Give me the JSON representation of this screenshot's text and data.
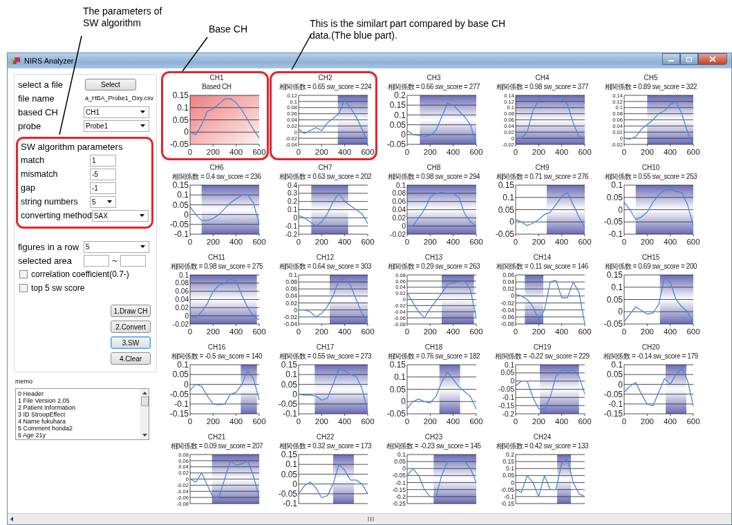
{
  "annotations": [
    {
      "text": "The parameters of SW algorithm"
    },
    {
      "text": "Base CH"
    },
    {
      "text": "This is the similart part compared by base CH data.(The blue part)."
    }
  ],
  "window": {
    "title": "NIRS Analyzer"
  },
  "file_panel": {
    "select_label": "select a file",
    "select_button": "Select",
    "file_name_label": "file name",
    "file_name": "a_HBA_Probe1_Oxy.csv",
    "based_ch_label": "based CH",
    "based_ch": "CH1",
    "probe_label": "probe",
    "probe": "Probe1"
  },
  "sw_parameters": {
    "title": "SW algorithm parameters",
    "highlighted": true,
    "fields": [
      {
        "label": "match",
        "value": "1",
        "kind": "text"
      },
      {
        "label": "mismatch",
        "value": "-5",
        "kind": "text"
      },
      {
        "label": "gap",
        "value": "-1",
        "kind": "text"
      },
      {
        "label": "string numbers",
        "value": "5",
        "kind": "dropdown"
      },
      {
        "label": "converting method",
        "value": "SAX",
        "kind": "dropdown"
      }
    ]
  },
  "display": {
    "figures_label": "figures in a row",
    "figures": "5",
    "area_label": "selected area",
    "area_separator": "～"
  },
  "options": [
    {
      "label": "correlation coefficient(0.7-)",
      "checked": false
    },
    {
      "label": "top 5 sw score",
      "checked": false
    }
  ],
  "buttons": [
    {
      "label": "1.Draw CH",
      "focused": false
    },
    {
      "label": "2.Convert",
      "focused": false
    },
    {
      "label": "3.SW",
      "focused": true
    },
    {
      "label": "4.Clear",
      "focused": false
    }
  ],
  "memo": {
    "label": "memo",
    "lines": [
      "0  Header",
      "1  File Version 2.05",
      "2  Patient Information",
      "3  ID StroopEffect",
      "4  Name fukuhara",
      "5  Comment honda2",
      "6  Age 21y"
    ]
  },
  "charts": [
    {
      "title": "CH1",
      "subtitle": "Based CH",
      "kind": "base",
      "highlighted": true,
      "chart_data": {
        "type": "line",
        "grid": true,
        "x": [
          0,
          50,
          100,
          150,
          200,
          250,
          300,
          350,
          400,
          450,
          500,
          550,
          600
        ],
        "xlim": [
          0,
          600
        ],
        "ylim": [
          -0.05,
          0.15
        ],
        "xticks": [
          0,
          200,
          400,
          600
        ],
        "yticks": [
          -0.05,
          0,
          0.05,
          0.1,
          0.15
        ],
        "series": [
          {
            "color": "#4a86d4",
            "values": [
              0,
              -0.01,
              0.03,
              0.085,
              0.095,
              0.115,
              0.135,
              0.137,
              0.12,
              0.09,
              0.05,
              0.01,
              -0.025
            ]
          }
        ]
      }
    },
    {
      "title": "CH2",
      "subtitle": "相関係数 = 0.65 sw_score = 224",
      "kind": "compared",
      "highlighted": true,
      "chart_data": {
        "type": "line",
        "grid": true,
        "x": [
          0,
          50,
          100,
          150,
          200,
          250,
          300,
          350,
          400,
          450,
          500,
          550,
          600
        ],
        "xlim": [
          0,
          600
        ],
        "ylim": [
          -0.04,
          0.12
        ],
        "xticks": [
          0,
          200,
          400,
          600
        ],
        "yticks": [
          -0.04,
          -0.02,
          0,
          0.02,
          0.04,
          0.06,
          0.08,
          0.1,
          0.12
        ],
        "series": [
          {
            "color": "#4a86d4",
            "values": [
              0.01,
              -0.005,
              0.005,
              0.015,
              0.005,
              0.03,
              0.045,
              0.06,
              0.105,
              0.08,
              0.05,
              0.01,
              -0.035
            ]
          }
        ],
        "bands": [
          {
            "axis": "x",
            "from": 340,
            "to": 600
          }
        ]
      }
    },
    {
      "title": "CH3",
      "subtitle": "相関係数 = 0.66 sw_score = 277",
      "kind": "compared",
      "highlighted": false,
      "chart_data": {
        "type": "line",
        "grid": true,
        "x": [
          0,
          50,
          100,
          150,
          200,
          250,
          300,
          350,
          400,
          450,
          500,
          550,
          600
        ],
        "xlim": [
          0,
          600
        ],
        "ylim": [
          -0.05,
          0.2
        ],
        "xticks": [
          0,
          200,
          400,
          600
        ],
        "yticks": [
          -0.05,
          0,
          0.05,
          0.1,
          0.15,
          0.2
        ],
        "series": [
          {
            "color": "#4a86d4",
            "values": [
              0.02,
              0,
              -0.005,
              -0.01,
              -0.005,
              0.02,
              0.09,
              0.16,
              0.15,
              0.12,
              0.09,
              0.05,
              -0.05
            ]
          }
        ],
        "bands": [
          {
            "axis": "x",
            "from": 110,
            "to": 600
          }
        ]
      }
    },
    {
      "title": "CH4",
      "subtitle": "相関係数 = 0.98 sw_score = 377",
      "kind": "compared",
      "highlighted": false,
      "chart_data": {
        "type": "line",
        "grid": true,
        "x": [
          0,
          50,
          100,
          150,
          200,
          250,
          300,
          350,
          400,
          450,
          500,
          550,
          600
        ],
        "xlim": [
          0,
          600
        ],
        "ylim": [
          -0.02,
          0.14
        ],
        "xticks": [
          0,
          200,
          400,
          600
        ],
        "yticks": [
          -0.02,
          0,
          0.02,
          0.04,
          0.06,
          0.08,
          0.1,
          0.12,
          0.14
        ],
        "series": [
          {
            "color": "#4a86d4",
            "values": [
              0,
              0,
              0.02,
              0.09,
              0.125,
              0.133,
              0.135,
              0.132,
              0.13,
              0.11,
              0.05,
              0.005,
              0
            ]
          }
        ],
        "bands": [
          {
            "axis": "x",
            "from": 0,
            "to": 600
          }
        ]
      }
    },
    {
      "title": "CH5",
      "subtitle": "相関係数 = 0.89 sw_score = 322",
      "kind": "compared",
      "highlighted": false,
      "chart_data": {
        "type": "line",
        "grid": true,
        "x": [
          0,
          50,
          100,
          150,
          200,
          250,
          300,
          350,
          400,
          450,
          500,
          550,
          600
        ],
        "xlim": [
          0,
          600
        ],
        "ylim": [
          -0.02,
          0.14
        ],
        "xticks": [
          0,
          200,
          400,
          600
        ],
        "yticks": [
          -0.02,
          0,
          0.02,
          0.04,
          0.06,
          0.08,
          0.1,
          0.12,
          0.14
        ],
        "series": [
          {
            "color": "#4a86d4",
            "values": [
              0,
              -0.003,
              0.005,
              0.03,
              0.045,
              0.06,
              0.08,
              0.09,
              0.11,
              0.12,
              0.08,
              0.02,
              -0.02
            ]
          }
        ],
        "bands": [
          {
            "axis": "x",
            "from": 200,
            "to": 600
          }
        ]
      }
    },
    {
      "title": "CH6",
      "subtitle": "相関係数 = 0.4 sw_score = 236",
      "kind": "compared",
      "highlighted": false,
      "chart_data": {
        "type": "line",
        "grid": true,
        "x": [
          0,
          50,
          100,
          150,
          200,
          250,
          300,
          350,
          400,
          450,
          500,
          550,
          600
        ],
        "xlim": [
          0,
          600
        ],
        "ylim": [
          -0.1,
          0.15
        ],
        "xticks": [
          0,
          200,
          400,
          600
        ],
        "yticks": [
          -0.1,
          -0.05,
          0,
          0.05,
          0.1,
          0.15
        ],
        "series": [
          {
            "color": "#4a86d4",
            "values": [
              0.04,
              0,
              -0.03,
              -0.03,
              -0.02,
              0,
              0.03,
              0.06,
              0.08,
              0.1,
              0.1,
              0.06,
              -0.05
            ]
          }
        ],
        "bands": [
          {
            "axis": "x",
            "from": 100,
            "to": 600
          }
        ]
      }
    },
    {
      "title": "CH7",
      "subtitle": "相関係数 = 0.63 sw_score = 202",
      "kind": "compared",
      "highlighted": false,
      "chart_data": {
        "type": "line",
        "grid": true,
        "x": [
          0,
          50,
          100,
          150,
          200,
          250,
          300,
          350,
          400,
          450,
          500,
          550,
          600
        ],
        "xlim": [
          0,
          600
        ],
        "ylim": [
          -0.2,
          0.4
        ],
        "xticks": [
          0,
          200,
          400,
          600
        ],
        "yticks": [
          -0.2,
          -0.1,
          0,
          0.1,
          0.2,
          0.3,
          0.4
        ],
        "series": [
          {
            "color": "#4a86d4",
            "values": [
              0.03,
              0,
              -0.05,
              -0.1,
              -0.05,
              0.05,
              0.2,
              0.3,
              0.2,
              0.15,
              0.1,
              0.05,
              -0.07
            ]
          }
        ],
        "bands": [
          {
            "axis": "x",
            "from": 110,
            "to": 430
          }
        ]
      }
    },
    {
      "title": "CH8",
      "subtitle": "相関係数 = 0.98 sw_score = 294",
      "kind": "compared",
      "highlighted": false,
      "chart_data": {
        "type": "line",
        "grid": true,
        "x": [
          0,
          50,
          100,
          150,
          200,
          250,
          300,
          350,
          400,
          450,
          500,
          550,
          600
        ],
        "xlim": [
          0,
          600
        ],
        "ylim": [
          -0.02,
          0.1
        ],
        "xticks": [
          0,
          200,
          400,
          600
        ],
        "yticks": [
          -0.02,
          0,
          0.02,
          0.04,
          0.06,
          0.08,
          0.1
        ],
        "series": [
          {
            "color": "#4a86d4",
            "values": [
              0,
              0,
              0.02,
              0.04,
              0.07,
              0.08,
              0.082,
              0.08,
              0.08,
              0.07,
              0.03,
              0.01,
              0
            ]
          }
        ],
        "bands": [
          {
            "axis": "x",
            "from": 0,
            "to": 600
          }
        ]
      }
    },
    {
      "title": "CH9",
      "subtitle": "相関係数 = 0.71 sw_score = 276",
      "kind": "compared",
      "highlighted": false,
      "chart_data": {
        "type": "line",
        "grid": true,
        "x": [
          0,
          50,
          100,
          150,
          200,
          250,
          300,
          350,
          400,
          450,
          500,
          550,
          600
        ],
        "xlim": [
          0,
          600
        ],
        "ylim": [
          -0.05,
          0.15
        ],
        "xticks": [
          0,
          200,
          400,
          600
        ],
        "yticks": [
          -0.05,
          0,
          0.05,
          0.1,
          0.15
        ],
        "series": [
          {
            "color": "#4a86d4",
            "values": [
              0.01,
              0,
              -0.015,
              -0.005,
              0.01,
              0.03,
              0.04,
              0.07,
              0.105,
              0.12,
              0.07,
              0.02,
              -0.025
            ]
          }
        ],
        "bands": [
          {
            "axis": "x",
            "from": 270,
            "to": 600
          }
        ]
      }
    },
    {
      "title": "CH10",
      "subtitle": "相関係数 = 0.55 sw_score = 253",
      "kind": "compared",
      "highlighted": false,
      "chart_data": {
        "type": "line",
        "grid": true,
        "x": [
          0,
          50,
          100,
          150,
          200,
          250,
          300,
          350,
          400,
          450,
          500,
          550,
          600
        ],
        "xlim": [
          0,
          600
        ],
        "ylim": [
          -0.1,
          0.1
        ],
        "xticks": [
          0,
          200,
          400,
          600
        ],
        "yticks": [
          -0.1,
          -0.05,
          0,
          0.05,
          0.1
        ],
        "series": [
          {
            "color": "#4a86d4",
            "values": [
              0.03,
              0,
              -0.04,
              -0.03,
              -0.01,
              0.03,
              0.06,
              0.08,
              0.085,
              0.075,
              0.07,
              0.02,
              -0.065
            ]
          }
        ],
        "bands": [
          {
            "axis": "x",
            "from": 100,
            "to": 600
          }
        ]
      }
    },
    {
      "title": "CH11",
      "subtitle": "相関係数 = 0.98 sw_score = 275",
      "kind": "compared",
      "highlighted": false,
      "chart_data": {
        "type": "line",
        "grid": true,
        "x": [
          0,
          50,
          100,
          150,
          200,
          250,
          300,
          350,
          400,
          450,
          500,
          550,
          600
        ],
        "xlim": [
          0,
          600
        ],
        "ylim": [
          -0.02,
          0.1
        ],
        "xticks": [
          0,
          200,
          400,
          600
        ],
        "yticks": [
          -0.02,
          0,
          0.02,
          0.04,
          0.06,
          0.08,
          0.1
        ],
        "series": [
          {
            "color": "#4a86d4",
            "values": [
              0,
              -0.005,
              0.01,
              0.03,
              0.06,
              0.075,
              0.08,
              0.09,
              0.085,
              0.05,
              0.02,
              0,
              -0.01
            ]
          }
        ],
        "bands": [
          {
            "axis": "x",
            "from": 0,
            "to": 580
          }
        ]
      }
    },
    {
      "title": "CH12",
      "subtitle": "相関係数 = 0.64 sw_score = 303",
      "kind": "compared",
      "highlighted": false,
      "chart_data": {
        "type": "line",
        "grid": true,
        "x": [
          0,
          50,
          100,
          150,
          200,
          250,
          300,
          350,
          400,
          450,
          500,
          550,
          600
        ],
        "xlim": [
          0,
          600
        ],
        "ylim": [
          -0.04,
          0.1
        ],
        "xticks": [
          0,
          200,
          400,
          600
        ],
        "yticks": [
          -0.04,
          -0.02,
          0,
          0.02,
          0.04,
          0.06,
          0.08,
          0.1
        ],
        "series": [
          {
            "color": "#4a86d4",
            "values": [
              0,
              0,
              -0.005,
              -0.02,
              -0.01,
              0.01,
              0.04,
              0.085,
              0.09,
              0.07,
              0.03,
              -0.01,
              -0.035
            ]
          }
        ],
        "bands": [
          {
            "axis": "x",
            "from": 270,
            "to": 600
          }
        ]
      }
    },
    {
      "title": "CH13",
      "subtitle": "相関係数 = 0.29 sw_score = 263",
      "kind": "compared",
      "highlighted": false,
      "chart_data": {
        "type": "line",
        "grid": true,
        "x": [
          0,
          50,
          100,
          150,
          200,
          250,
          300,
          350,
          400,
          450,
          500,
          550,
          600
        ],
        "xlim": [
          0,
          600
        ],
        "ylim": [
          -0.08,
          0.08
        ],
        "xticks": [
          0,
          200,
          400,
          600
        ],
        "yticks": [
          -0.08,
          -0.06,
          -0.04,
          -0.02,
          0,
          0.02,
          0.04,
          0.06,
          0.08
        ],
        "series": [
          {
            "color": "#4a86d4",
            "values": [
              0.02,
              -0.01,
              -0.04,
              -0.06,
              -0.03,
              -0.005,
              0.02,
              0.05,
              0.055,
              0.058,
              0.06,
              0.03,
              -0.06
            ]
          }
        ],
        "bands": [
          {
            "axis": "x",
            "from": 300,
            "to": 580
          }
        ]
      }
    },
    {
      "title": "CH14",
      "subtitle": "相関係数 = 0.11 sw_score = 146",
      "kind": "compared",
      "highlighted": false,
      "chart_data": {
        "type": "line",
        "grid": true,
        "x": [
          0,
          50,
          100,
          150,
          200,
          250,
          300,
          350,
          400,
          450,
          500,
          550,
          600
        ],
        "xlim": [
          0,
          600
        ],
        "ylim": [
          -0.08,
          0.06
        ],
        "xticks": [
          0,
          200,
          400,
          600
        ],
        "yticks": [
          -0.08,
          -0.06,
          -0.04,
          -0.02,
          0,
          0.02,
          0.04,
          0.06
        ],
        "series": [
          {
            "color": "#4a86d4",
            "values": [
              0.005,
              0,
              -0.01,
              -0.03,
              -0.07,
              -0.04,
              0.04,
              0.045,
              -0.005,
              -0.005,
              0.04,
              0.01,
              -0.08
            ]
          }
        ],
        "bands": [
          {
            "axis": "x",
            "from": 80,
            "to": 240
          }
        ]
      }
    },
    {
      "title": "CH15",
      "subtitle": "相関係数 = 0.69 sw_score = 200",
      "kind": "compared",
      "highlighted": false,
      "chart_data": {
        "type": "line",
        "grid": true,
        "x": [
          0,
          50,
          100,
          150,
          200,
          250,
          300,
          350,
          400,
          450,
          500,
          550,
          600
        ],
        "xlim": [
          0,
          600
        ],
        "ylim": [
          -0.05,
          0.15
        ],
        "xticks": [
          0,
          200,
          400,
          600
        ],
        "yticks": [
          -0.05,
          0,
          0.05,
          0.1,
          0.15
        ],
        "series": [
          {
            "color": "#4a86d4",
            "values": [
              -0.04,
              -0.01,
              0.02,
              0.005,
              -0.01,
              -0.005,
              0.03,
              0.14,
              0.12,
              0.05,
              0.02,
              0,
              -0.05
            ]
          }
        ],
        "bands": [
          {
            "axis": "x",
            "from": 310,
            "to": 600
          }
        ]
      }
    },
    {
      "title": "CH16",
      "subtitle": "相関係数 = -0.5 sw_score = 140",
      "kind": "compared",
      "highlighted": false,
      "chart_data": {
        "type": "line",
        "grid": true,
        "x": [
          0,
          50,
          100,
          150,
          200,
          250,
          300,
          350,
          400,
          450,
          500,
          550,
          600
        ],
        "xlim": [
          0,
          600
        ],
        "ylim": [
          -0.15,
          0.1
        ],
        "xticks": [
          0,
          200,
          400,
          600
        ],
        "yticks": [
          -0.15,
          -0.1,
          -0.05,
          0,
          0.05,
          0.1
        ],
        "series": [
          {
            "color": "#4a86d4",
            "values": [
              -0.03,
              0,
              -0.01,
              -0.06,
              -0.1,
              -0.105,
              -0.1,
              -0.05,
              -0.04,
              0,
              0.07,
              0.03,
              -0.08
            ]
          }
        ],
        "bands": [
          {
            "axis": "x",
            "from": 440,
            "to": 580
          }
        ]
      }
    },
    {
      "title": "CH17",
      "subtitle": "相関係数 = 0.55 sw_score = 273",
      "kind": "compared",
      "highlighted": false,
      "chart_data": {
        "type": "line",
        "grid": true,
        "x": [
          0,
          50,
          100,
          150,
          200,
          250,
          300,
          350,
          400,
          450,
          500,
          550,
          600
        ],
        "xlim": [
          0,
          600
        ],
        "ylim": [
          -0.1,
          0.15
        ],
        "xticks": [
          0,
          200,
          400,
          600
        ],
        "yticks": [
          -0.1,
          -0.05,
          0,
          0.05,
          0.1,
          0.15
        ],
        "series": [
          {
            "color": "#4a86d4",
            "values": [
              0,
              -0.005,
              -0.005,
              -0.01,
              -0.03,
              -0.02,
              0.05,
              0.13,
              0.12,
              0.1,
              0.09,
              0.03,
              -0.09
            ]
          }
        ],
        "bands": [
          {
            "axis": "x",
            "from": 140,
            "to": 600
          }
        ]
      }
    },
    {
      "title": "CH18",
      "subtitle": "相関係数 = 0.76 sw_score = 182",
      "kind": "compared",
      "highlighted": false,
      "chart_data": {
        "type": "line",
        "grid": true,
        "x": [
          0,
          50,
          100,
          150,
          200,
          250,
          300,
          350,
          400,
          450,
          500,
          550,
          600
        ],
        "xlim": [
          0,
          600
        ],
        "ylim": [
          -0.05,
          0.15
        ],
        "xticks": [
          0,
          200,
          400,
          600
        ],
        "yticks": [
          -0.05,
          0,
          0.05,
          0.1,
          0.15
        ],
        "series": [
          {
            "color": "#4a86d4",
            "values": [
              -0.03,
              0,
              0.01,
              0,
              -0.005,
              0.02,
              0.08,
              0.12,
              0.09,
              0.06,
              0.04,
              0.02,
              -0.03
            ]
          }
        ],
        "bands": [
          {
            "axis": "x",
            "from": 280,
            "to": 460
          }
        ]
      }
    },
    {
      "title": "CH19",
      "subtitle": "相関係数 = -0.22 sw_score = 229",
      "kind": "compared",
      "highlighted": false,
      "chart_data": {
        "type": "line",
        "grid": true,
        "x": [
          0,
          50,
          100,
          150,
          200,
          250,
          300,
          350,
          400,
          450,
          500,
          550,
          600
        ],
        "xlim": [
          0,
          600
        ],
        "ylim": [
          -0.2,
          0.1
        ],
        "xticks": [
          0,
          200,
          400,
          600
        ],
        "yticks": [
          -0.2,
          -0.15,
          -0.1,
          -0.05,
          0,
          0.05,
          0.1
        ],
        "series": [
          {
            "color": "#4a86d4",
            "values": [
              -0.03,
              0,
              0,
              -0.1,
              -0.17,
              -0.17,
              -0.1,
              0.03,
              0.07,
              0.06,
              0.07,
              0.03,
              -0.08
            ]
          }
        ],
        "bands": [
          {
            "axis": "x",
            "from": 210,
            "to": 550
          }
        ]
      }
    },
    {
      "title": "CH20",
      "subtitle": "相関係数 = -0.14 sw_score = 179",
      "kind": "compared",
      "highlighted": false,
      "chart_data": {
        "type": "line",
        "grid": true,
        "x": [
          0,
          50,
          100,
          150,
          200,
          250,
          300,
          350,
          400,
          450,
          500,
          550,
          600
        ],
        "xlim": [
          0,
          600
        ],
        "ylim": [
          -0.15,
          0.1
        ],
        "xticks": [
          0,
          200,
          400,
          600
        ],
        "yticks": [
          -0.15,
          -0.1,
          -0.05,
          0,
          0.05,
          0.1
        ],
        "series": [
          {
            "color": "#4a86d4",
            "values": [
              -0.04,
              -0.01,
              0.01,
              -0.05,
              -0.1,
              -0.11,
              -0.04,
              0.03,
              0,
              0.05,
              0.08,
              0.02,
              -0.11
            ]
          }
        ],
        "bands": [
          {
            "axis": "x",
            "from": 360,
            "to": 540
          }
        ]
      }
    },
    {
      "title": "CH21",
      "subtitle": "相関係数 = 0.09 sw_score = 207",
      "kind": "compared",
      "highlighted": false,
      "chart_data": {
        "type": "line",
        "grid": true,
        "x": [
          0,
          50,
          100,
          150,
          200,
          250,
          300,
          350,
          400,
          450,
          500,
          550,
          600
        ],
        "xlim": [
          0,
          600
        ],
        "ylim": [
          -0.08,
          0.08
        ],
        "yticks": [
          -0.08,
          -0.06,
          -0.04,
          -0.02,
          0,
          0.02,
          0.04,
          0.06,
          0.08
        ],
        "series": [
          {
            "color": "#4a86d4",
            "values": [
              0,
              -0.01,
              0.02,
              -0.02,
              -0.06,
              -0.06,
              0,
              0.06,
              0.045,
              0.05,
              0.06,
              0.01,
              -0.06
            ]
          }
        ],
        "bands": [
          {
            "axis": "x",
            "from": 190,
            "to": 600
          }
        ]
      }
    },
    {
      "title": "CH22",
      "subtitle": "相関係数 = 0.32 sw_score = 173",
      "kind": "compared",
      "highlighted": false,
      "chart_data": {
        "type": "line",
        "grid": true,
        "x": [
          0,
          50,
          100,
          150,
          200,
          250,
          300,
          350,
          400,
          450,
          500,
          550,
          600
        ],
        "xlim": [
          0,
          600
        ],
        "ylim": [
          -0.1,
          0.15
        ],
        "yticks": [
          -0.1,
          -0.05,
          0,
          0.05,
          0.1,
          0.15
        ],
        "series": [
          {
            "color": "#4a86d4",
            "values": [
              -0.05,
              -0.01,
              0.01,
              -0.02,
              -0.07,
              -0.06,
              0,
              0.1,
              0.07,
              0.02,
              0.02,
              0,
              -0.05
            ]
          }
        ],
        "bands": [
          {
            "axis": "x",
            "from": 300,
            "to": 480
          }
        ]
      }
    },
    {
      "title": "CH23",
      "subtitle": "相関係数 = -0.23 sw_score = 145",
      "kind": "compared",
      "highlighted": false,
      "chart_data": {
        "type": "line",
        "grid": true,
        "x": [
          0,
          50,
          100,
          150,
          200,
          250,
          300,
          350,
          400,
          450,
          500,
          550,
          600
        ],
        "xlim": [
          0,
          600
        ],
        "ylim": [
          -0.25,
          0.1
        ],
        "yticks": [
          -0.25,
          -0.2,
          -0.15,
          -0.1,
          -0.05,
          0,
          0.05,
          0.1
        ],
        "series": [
          {
            "color": "#4a86d4",
            "values": [
              -0.05,
              0,
              -0.05,
              -0.15,
              -0.2,
              -0.2,
              -0.05,
              0.05,
              0.05,
              0.05,
              0.05,
              0,
              -0.1
            ]
          }
        ],
        "bands": [
          {
            "axis": "x",
            "from": 230,
            "to": 600
          }
        ]
      }
    },
    {
      "title": "CH24",
      "subtitle": "相関係数 = 0.42 sw_score = 133",
      "kind": "compared",
      "highlighted": false,
      "chart_data": {
        "type": "line",
        "grid": true,
        "x": [
          0,
          50,
          100,
          150,
          200,
          250,
          300,
          350,
          400,
          450,
          500,
          550,
          600
        ],
        "xlim": [
          0,
          600
        ],
        "ylim": [
          -0.15,
          0.2
        ],
        "yticks": [
          -0.15,
          -0.1,
          -0.05,
          0,
          0.05,
          0.1,
          0.15,
          0.2
        ],
        "series": [
          {
            "color": "#4a86d4",
            "values": [
              -0.05,
              -0.07,
              0.05,
              0,
              -0.1,
              0.05,
              -0.05,
              -0.05,
              0.14,
              0.17,
              0,
              -0.08,
              -0.1
            ]
          }
        ],
        "bands": [
          {
            "axis": "x",
            "from": 360,
            "to": 480
          }
        ]
      }
    }
  ]
}
